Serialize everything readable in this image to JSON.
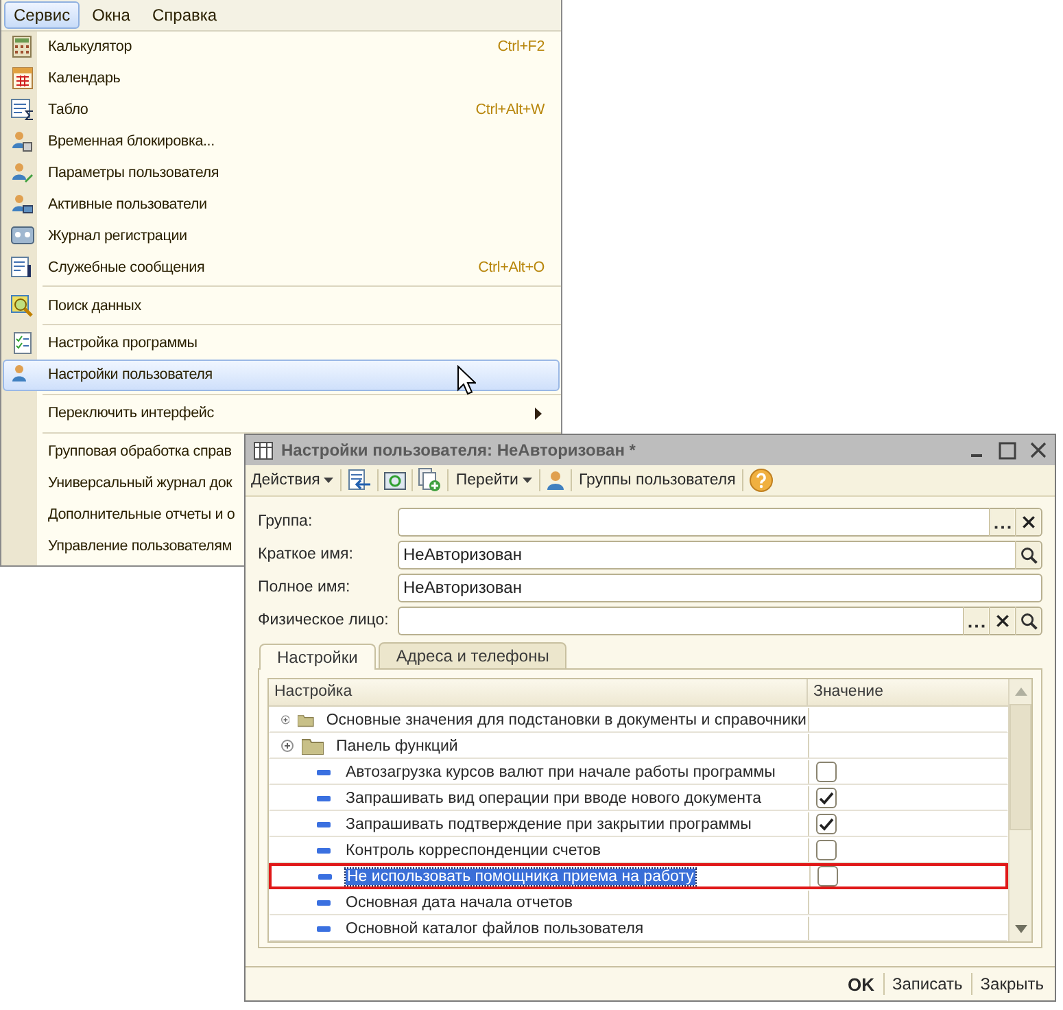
{
  "menubar": [
    {
      "label": "Сервис",
      "selected": true
    },
    {
      "label": "Окна",
      "selected": false
    },
    {
      "label": "Справка",
      "selected": false
    }
  ],
  "menu": {
    "groups": [
      {
        "items": [
          {
            "label": "Калькулятор",
            "shortcut": "Ctrl+F2",
            "selected": false
          },
          {
            "label": "Календарь",
            "selected": false
          },
          {
            "label": "Табло",
            "shortcut": "Ctrl+Alt+W",
            "selected": false
          },
          {
            "label": "Временная блокировка...",
            "selected": false
          },
          {
            "label": "Параметры пользователя",
            "selected": false
          },
          {
            "label": "Активные пользователи",
            "selected": false
          },
          {
            "label": "Журнал регистрации",
            "selected": false
          },
          {
            "label": "Служебные сообщения",
            "shortcut": "Ctrl+Alt+O",
            "selected": false
          }
        ]
      },
      {
        "items": [
          {
            "label": "Поиск данных",
            "selected": false
          }
        ]
      },
      {
        "items": [
          {
            "label": "Настройка программы",
            "selected": false
          },
          {
            "label": "Настройки пользователя",
            "selected": true
          }
        ]
      },
      {
        "items": [
          {
            "label": "Переключить интерфейс",
            "selected": false,
            "submenu": true
          }
        ]
      },
      {
        "items": [
          {
            "label": "Групповая обработка справ",
            "selected": false
          },
          {
            "label": "Универсальный журнал док",
            "selected": false
          },
          {
            "label": "Дополнительные отчеты и о",
            "selected": false
          },
          {
            "label": "Управление пользователям",
            "selected": false
          }
        ]
      }
    ]
  },
  "dialog": {
    "title": "Настройки пользователя: НеАвторизован *",
    "toolbar": [
      {
        "kind": "dropdown",
        "label": "Действия"
      },
      {
        "kind": "icon"
      },
      {
        "kind": "icon"
      },
      {
        "kind": "icon"
      },
      {
        "kind": "dropdown",
        "label": "Перейти"
      },
      {
        "kind": "icon"
      },
      {
        "kind": "text",
        "label": "Группы пользователя"
      },
      {
        "kind": "icon"
      }
    ],
    "fields": [
      {
        "label": "Группа:",
        "kind": "reference"
      },
      {
        "label": "Краткое имя:",
        "value": "НеАвторизован",
        "kind": "search"
      },
      {
        "label": "Полное имя:",
        "value": "НеАвторизован",
        "kind": "plain"
      },
      {
        "label": "Физическое лицо:",
        "kind": "reference_search"
      }
    ],
    "tabs": [
      {
        "label": "Настройки",
        "selected": true
      },
      {
        "label": "Адреса и телефоны",
        "selected": false
      }
    ],
    "table": {
      "columns": [
        "Настройка",
        "Значение"
      ],
      "rows": [
        {
          "kind": "group",
          "label": "Основные значения для подстановки в документы и справочники",
          "expanded": false,
          "selected": false,
          "outlined": false
        },
        {
          "kind": "group",
          "label": "Панель функций",
          "expanded": false,
          "selected": false,
          "outlined": false
        },
        {
          "kind": "flag",
          "label": "Автозагрузка курсов валют при начале работы программы",
          "checked": false,
          "selected": false,
          "outlined": false
        },
        {
          "kind": "flag",
          "label": "Запрашивать вид операции при вводе нового документа",
          "checked": true,
          "selected": false,
          "outlined": false
        },
        {
          "kind": "flag",
          "label": "Запрашивать подтверждение при закрытии программы",
          "checked": true,
          "selected": false,
          "outlined": false
        },
        {
          "kind": "flag",
          "label": "Контроль корреспонденции счетов",
          "checked": false,
          "selected": false,
          "outlined": false
        },
        {
          "kind": "flag",
          "label": "Не использовать помощника приема на работу",
          "checked": false,
          "selected": true,
          "outlined": true
        },
        {
          "kind": "setting",
          "label": "Основная дата начала отчетов",
          "selected": false,
          "outlined": false
        },
        {
          "kind": "setting",
          "label": "Основной каталог файлов пользователя",
          "selected": false,
          "outlined": false
        }
      ]
    },
    "footer": [
      {
        "label": "OK",
        "kind": "default"
      },
      {
        "label": "Записать",
        "kind": "normal"
      },
      {
        "label": "Закрыть",
        "kind": "normal"
      }
    ]
  }
}
